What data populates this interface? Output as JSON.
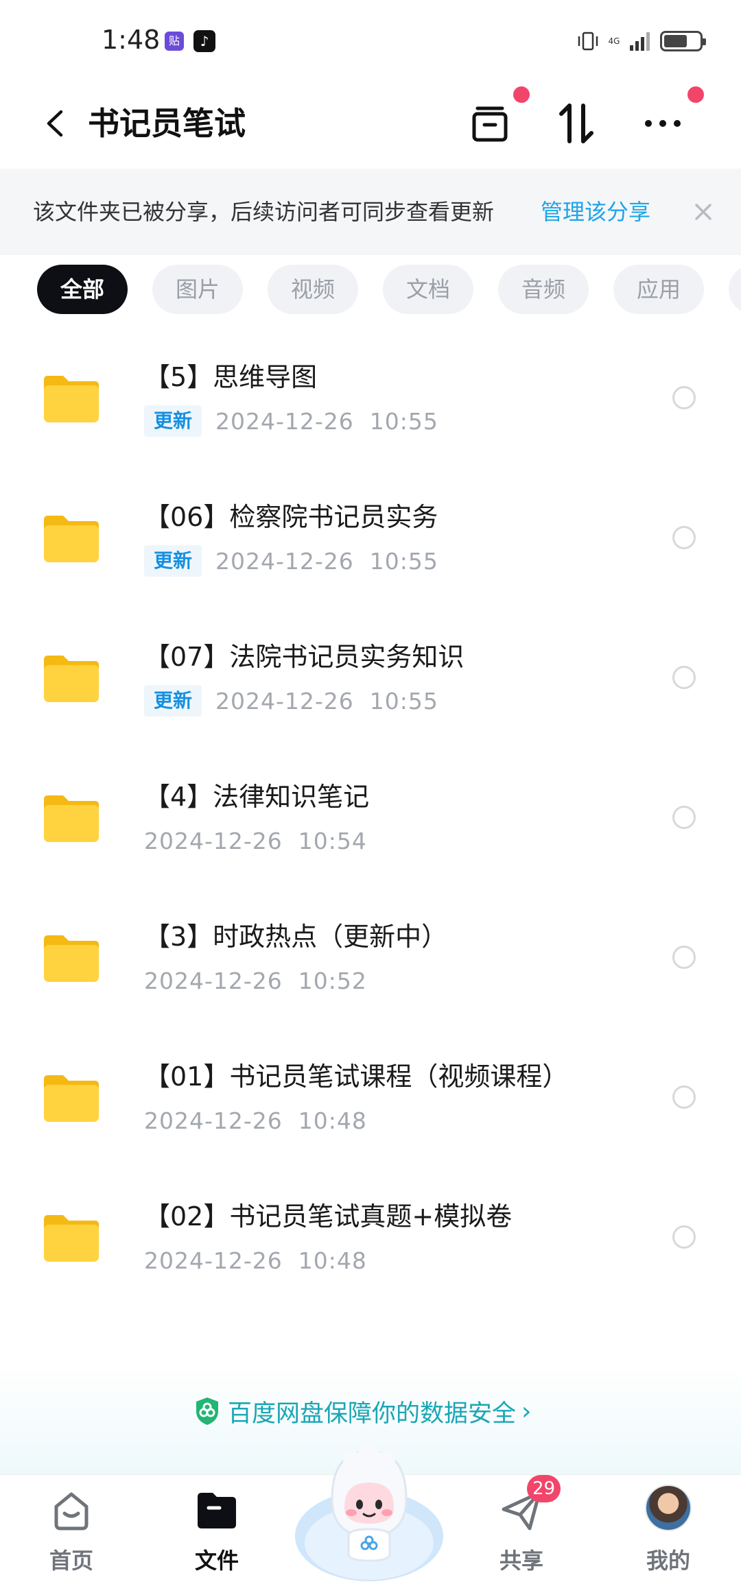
{
  "status_bar": {
    "time": "1:48",
    "app1": "贴",
    "app2": "♪",
    "network": "4G",
    "battery_level": 0.65
  },
  "header": {
    "title": "书记员笔试"
  },
  "banner": {
    "text": "该文件夹已被分享，后续访问者可同步查看更新",
    "link": "管理该分享"
  },
  "chips": [
    {
      "label": "全部",
      "active": true
    },
    {
      "label": "图片",
      "active": false
    },
    {
      "label": "视频",
      "active": false
    },
    {
      "label": "文档",
      "active": false
    },
    {
      "label": "音频",
      "active": false
    },
    {
      "label": "应用",
      "active": false
    }
  ],
  "files": [
    {
      "name": "【5】思维导图",
      "badge": "更新",
      "time": "2024-12-26  10:55"
    },
    {
      "name": "【06】检察院书记员实务",
      "badge": "更新",
      "time": "2024-12-26  10:55"
    },
    {
      "name": "【07】法院书记员实务知识",
      "badge": "更新",
      "time": "2024-12-26  10:55"
    },
    {
      "name": "【4】法律知识笔记",
      "badge": "",
      "time": "2024-12-26  10:54"
    },
    {
      "name": "【3】时政热点（更新中）",
      "badge": "",
      "time": "2024-12-26  10:52"
    },
    {
      "name": "【01】书记员笔试课程（视频课程）",
      "badge": "",
      "time": "2024-12-26  10:48"
    },
    {
      "name": "【02】书记员笔试真题+模拟卷",
      "badge": "",
      "time": "2024-12-26  10:48"
    }
  ],
  "security": {
    "text": "百度网盘保障你的数据安全"
  },
  "nav": {
    "home": "首页",
    "files": "文件",
    "share": "共享",
    "share_badge": "29",
    "mine": "我的"
  },
  "colors": {
    "accent": "#1da5e8",
    "badge_red": "#f2456a",
    "folder": "#ffd23f"
  }
}
